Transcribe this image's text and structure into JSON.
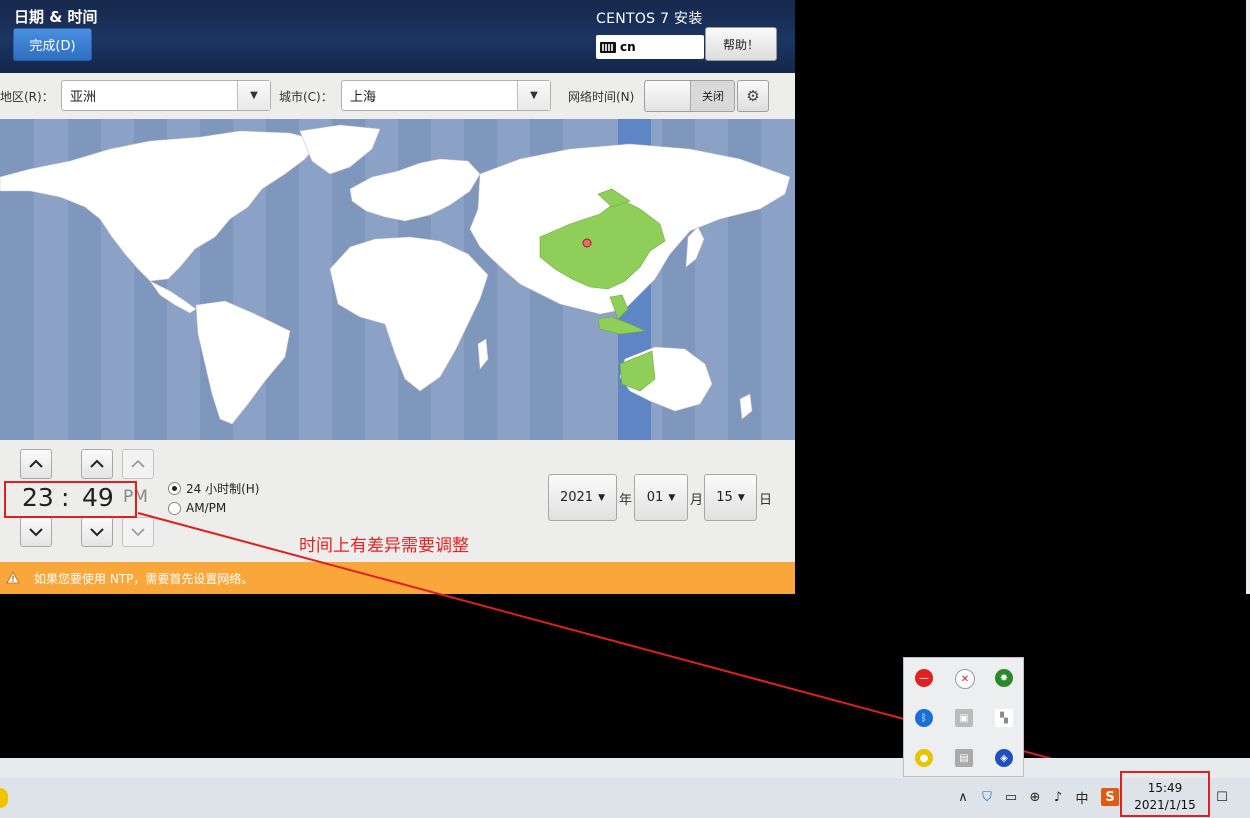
{
  "header": {
    "title": "日期 & 时间",
    "done_label": "完成(D)",
    "product": "CENTOS 7 安装",
    "keyboard_layout": "cn",
    "help_label": "帮助！"
  },
  "toolbar": {
    "region_label": "地区(R)：",
    "region_value": "亚洲",
    "city_label": "城市(C)：",
    "city_value": "上海",
    "network_time_label": "网络时间(N)",
    "network_time_state": "关闭",
    "network_time_on": false
  },
  "time": {
    "hours": "23",
    "separator": ":",
    "minutes": "49",
    "ampm": "PM",
    "format_24h_label": "24 小时制(H)",
    "format_ampm_label": "AM/PM",
    "format_selected": "24h"
  },
  "date": {
    "year": "2021",
    "year_unit": "年",
    "month": "01",
    "month_unit": "月",
    "day": "15",
    "day_unit": "日"
  },
  "warning": {
    "text": "如果您要使用 NTP，需要首先设置网络。"
  },
  "annotation": {
    "text": "时间上有差异需要调整",
    "color": "#e82020"
  },
  "taskbar": {
    "clock_time": "15:49",
    "clock_date": "2021/1/15",
    "ime_label": "中"
  },
  "colors": {
    "header_bg": "#1c3563",
    "accent_blue": "#2f6ec2",
    "map_water": "#8ba2c6",
    "map_land": "#ffffff",
    "map_selected": "#8fce58",
    "warning": "#f9a73b"
  }
}
